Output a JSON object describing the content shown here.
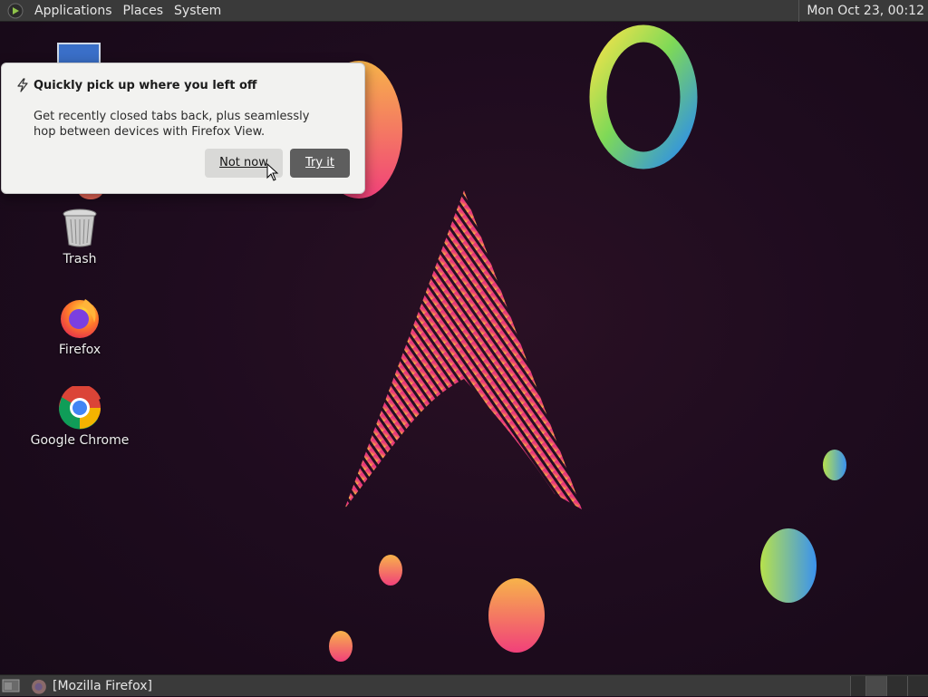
{
  "top_panel": {
    "menus": [
      "Applications",
      "Places",
      "System"
    ],
    "clock": "Mon Oct 23, 00:12"
  },
  "desktop_icons": [
    {
      "label": "Trash",
      "icon": "trash-icon"
    },
    {
      "label": "Firefox",
      "icon": "firefox-icon"
    },
    {
      "label": "Google Chrome",
      "icon": "chrome-icon"
    }
  ],
  "popup": {
    "title": "Quickly pick up where you left off",
    "body": "Get recently closed tabs back, plus seamlessly hop between devices with Firefox View.",
    "secondary_button": "Not now",
    "primary_button": "Try it"
  },
  "taskbar": {
    "task_label": "[Mozilla Firefox]"
  },
  "colors": {
    "panel": "#3a3a3a",
    "popup_bg": "#f2f2f0",
    "primary_button": "#5e5e5e",
    "arch_pink": "#e83a7c",
    "arch_yellow": "#f7d33c"
  }
}
